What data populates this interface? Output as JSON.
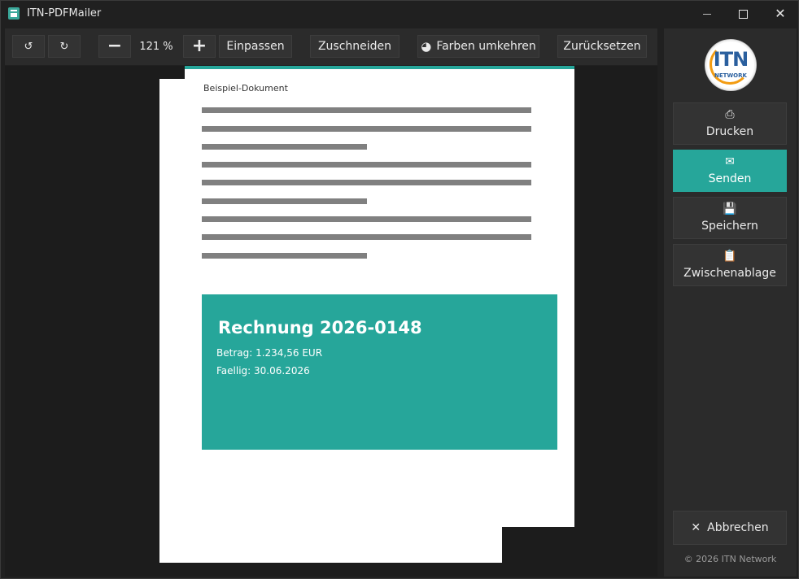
{
  "window": {
    "title": "ITN-PDFMailer"
  },
  "toolbar": {
    "rotate_left_icon": "↺",
    "rotate_right_icon": "↻",
    "zoom_out_icon": "−",
    "zoom_level": "121 %",
    "zoom_in_icon": "+",
    "fit_label": "Einpassen",
    "crop_label": "Zuschneiden",
    "invert_label": "Farben umkehren",
    "invert_icon": "◕",
    "reset_label": "Zurücksetzen"
  },
  "document": {
    "title": "Beispiel-Dokument",
    "invoice": {
      "title": "Rechnung 2026-0148",
      "amount": "Betrag: 1.234,56 EUR",
      "due": "Faellig: 30.06.2026"
    }
  },
  "sidebar": {
    "logo_text": "ITN",
    "logo_sub": "NETWORK",
    "buttons": [
      {
        "label": "Drucken",
        "icon": "⎙"
      },
      {
        "label": "Senden",
        "icon": "✉"
      },
      {
        "label": "Speichern",
        "icon": "💾"
      },
      {
        "label": "Zwischenablage",
        "icon": "📋"
      }
    ],
    "cancel_label": "Abbrechen",
    "cancel_icon": "✕",
    "footer": "© 2026 ITN Network"
  },
  "colors": {
    "accent": "#26a69a",
    "background": "#202020",
    "panel": "#2b2b2b",
    "button": "#333333"
  }
}
